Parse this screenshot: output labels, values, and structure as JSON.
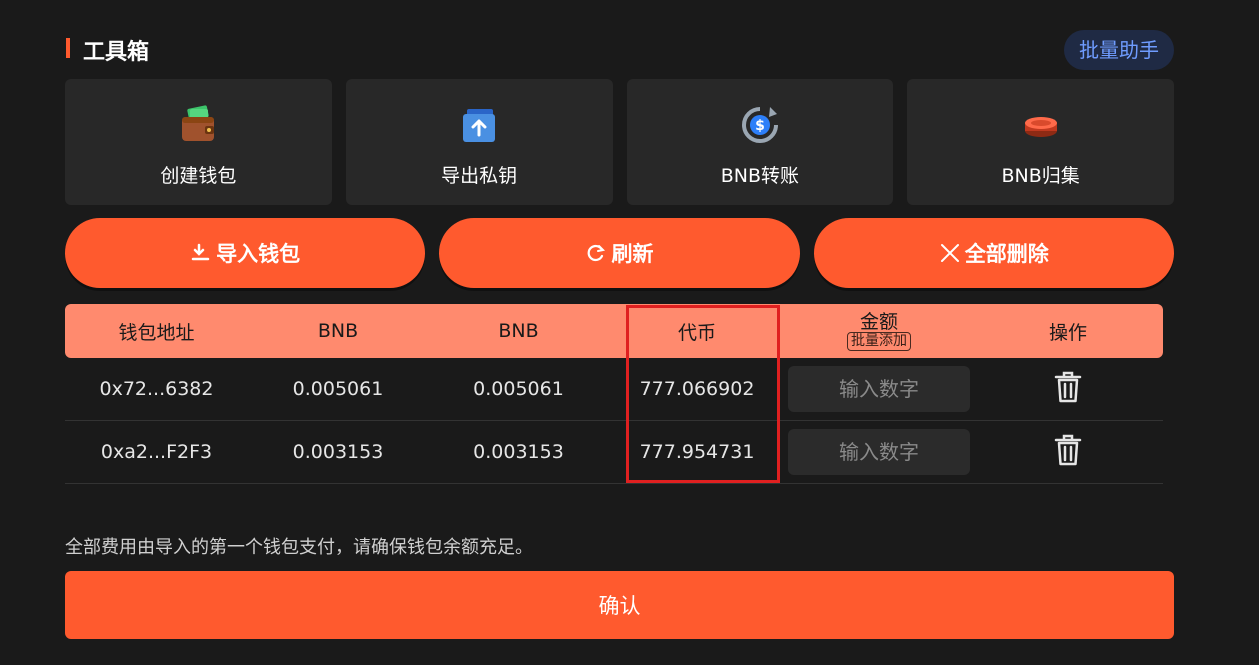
{
  "header": {
    "title": "工具箱",
    "batch_helper": "批量助手"
  },
  "tools": [
    {
      "label": "创建钱包",
      "icon": "wallet-icon"
    },
    {
      "label": "导出私钥",
      "icon": "export-icon"
    },
    {
      "label": "BNB转账",
      "icon": "transfer-icon"
    },
    {
      "label": "BNB归集",
      "icon": "collect-icon"
    }
  ],
  "actions": {
    "import_label": "导入钱包",
    "refresh_label": "刷新",
    "delete_all_label": "全部删除"
  },
  "table": {
    "headers": {
      "address": "钱包地址",
      "bnb1": "BNB",
      "bnb2": "BNB",
      "token": "代币",
      "amount": "金额",
      "batch_add": "批量添加",
      "operation": "操作"
    },
    "input_placeholder": "输入数字",
    "rows": [
      {
        "address": "0x72...6382",
        "bnb1": "0.005061",
        "bnb2": "0.005061",
        "token": "777.066902"
      },
      {
        "address": "0xa2...F2F3",
        "bnb1": "0.003153",
        "bnb2": "0.003153",
        "token": "777.954731"
      }
    ]
  },
  "note": "全部费用由导入的第一个钱包支付，请确保钱包余额充足。",
  "confirm_label": "确认",
  "colors": {
    "accent": "#ff5a2e",
    "header_bg": "#ff8a6e",
    "page_bg": "#1a1a1a",
    "highlight": "#e02020"
  }
}
